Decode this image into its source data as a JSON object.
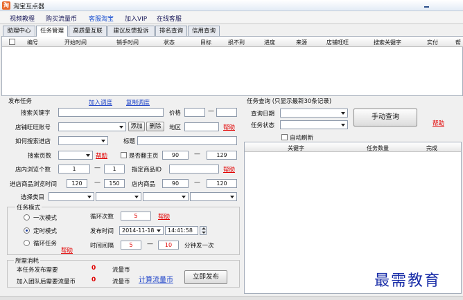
{
  "window": {
    "title": "淘宝互点器"
  },
  "menu": [
    "视频教程",
    "购买流量币",
    "客服淘宝",
    "加入VIP",
    "在线客服"
  ],
  "tabs": [
    "助理中心",
    "任务管理",
    "高质量互联",
    "建议反馈投诉",
    "排名查询",
    "信用查询"
  ],
  "grid": {
    "columns": [
      "编号",
      "开始时间",
      "销手时间",
      "状态",
      "目标",
      "损不到",
      "进度",
      "来源",
      "店铺旺旺",
      "搜索关键字",
      "实付",
      "帮"
    ]
  },
  "publish": {
    "title": "发布任务",
    "add_link": "加入调度",
    "copy_link": "复制调度",
    "keyword_label": "搜索关键字",
    "price_label": "价格",
    "shop_label": "店铺旺旺账号",
    "add_btn": "添加",
    "delete_btn": "删除",
    "region_label": "地区",
    "help": "帮助",
    "search_label": "如何搜索进店",
    "title_label": "标题",
    "pages_label": "搜索页数",
    "first_page_label": "是否翻主页",
    "pages_min": "90",
    "pages_max": "129",
    "browse_label": "店内浏览个数",
    "browse_min": "1",
    "browse_max": "1",
    "specified_label": "指定商品ID",
    "stay_label": "进店商品浏览时间",
    "stay_min": "120",
    "stay_max": "150",
    "instore_label": "店内商品",
    "instore_min": "90",
    "instore_max": "120",
    "category_label": "选择类目",
    "mode_title": "任务模式",
    "mode_once": "一次模式",
    "mode_timed": "定时模式",
    "mode_cycle": "循环任务",
    "repeat_label": "循环次数",
    "repeat_value": "5",
    "time_label": "发布时间",
    "time_date": "2014-11-18",
    "time_clock": "14:41:58",
    "interval_label": "时间间隔",
    "interval_min": "5",
    "interval_max": "10",
    "interval_unit": "分钟发一次",
    "cost_title": "所需消耗",
    "cost_line1": "本任务发布需要",
    "cost_line2": "加入团队后需要流量币",
    "cost_value1": "0",
    "cost_value2": "0",
    "cost_unit": "流量币",
    "calc_link": "计算流量币",
    "publish_btn": "立即发布"
  },
  "query": {
    "title": "任务查询 (只显示最新30条记录)",
    "date_label": "查询日期",
    "status_label": "任务状态",
    "manual_btn": "手动查询",
    "help": "帮助",
    "auto_refresh": "自动刷新",
    "columns": [
      "关键字",
      "任务数量",
      "完成"
    ]
  },
  "watermark": "最需教育",
  "icons": [
    "app-logo-icon",
    "minimize-icon",
    "checkbox-icon",
    "dropdown-arrow-icon",
    "radio-icon",
    "spinner-icon"
  ]
}
